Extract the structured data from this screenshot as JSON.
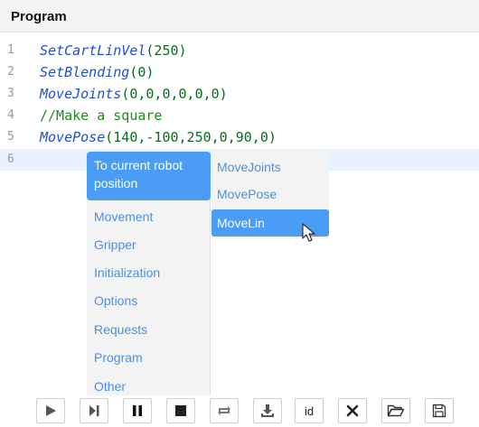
{
  "panel": {
    "title": "Program"
  },
  "editor": {
    "lines": [
      {
        "num": "1",
        "fn": "SetCartLinVel",
        "args": "(250)"
      },
      {
        "num": "2",
        "fn": "SetBlending",
        "args": "(0)"
      },
      {
        "num": "3",
        "fn": "MoveJoints",
        "args": "(0,0,0,0,0,0)"
      },
      {
        "num": "4",
        "comment": "//Make a square"
      },
      {
        "num": "5",
        "fn": "MovePose",
        "args": "(140,-100,250,0,90,0)"
      },
      {
        "num": "6"
      }
    ]
  },
  "autocomplete": {
    "categories": [
      {
        "label_line1": "To current robot",
        "label_line2": "position",
        "selected": true
      },
      {
        "label": "Movement"
      },
      {
        "label": "Gripper"
      },
      {
        "label": "Initialization"
      },
      {
        "label": "Options"
      },
      {
        "label": "Requests"
      },
      {
        "label": "Program"
      },
      {
        "label": "Other"
      }
    ],
    "submenu": [
      {
        "label": "MoveJoints"
      },
      {
        "label": "MovePose"
      },
      {
        "label": "MoveLin",
        "selected": true
      }
    ]
  },
  "toolbar": {
    "id_label": "id",
    "icons": [
      "play-icon",
      "step-icon",
      "pause-icon",
      "stop-icon",
      "loop-icon",
      "download-icon",
      "id-button",
      "close-icon",
      "folder-open-icon",
      "save-icon"
    ]
  },
  "colors": {
    "accent": "#4a9cf5",
    "function": "#1d4fd6",
    "comment": "#1f8a1f",
    "menu_text": "#4a90e2"
  }
}
